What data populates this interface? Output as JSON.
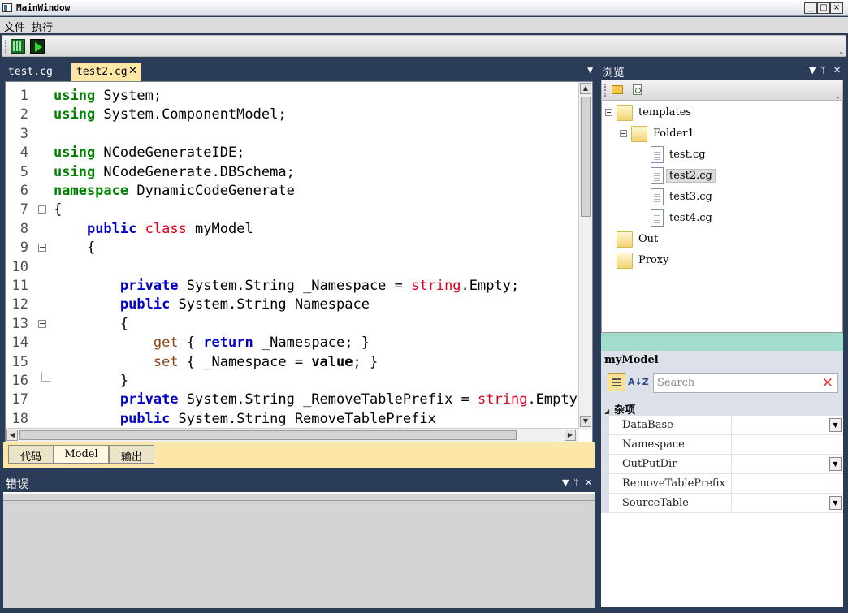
{
  "window": {
    "title": "MainWindow",
    "minimize": "_",
    "maximize": "□",
    "close": "×"
  },
  "menu": {
    "items": [
      "文件",
      "执行"
    ]
  },
  "toolbar": {
    "buttons": [
      "build-icon",
      "run-icon"
    ],
    "overflow": "⌄"
  },
  "doc_tabs": [
    {
      "label": "test.cg",
      "active": false
    },
    {
      "label": "test2.cg",
      "active": true,
      "close": "✕"
    }
  ],
  "doc_tabs_menu": "▼",
  "editor": {
    "lines": [
      {
        "n": "1",
        "fold": "",
        "segs": [
          [
            "k-green",
            "using"
          ],
          [
            "",
            " System;"
          ]
        ]
      },
      {
        "n": "2",
        "fold": "",
        "segs": [
          [
            "k-green",
            "using"
          ],
          [
            "",
            " System.ComponentModel;"
          ]
        ]
      },
      {
        "n": "3",
        "fold": "",
        "segs": []
      },
      {
        "n": "4",
        "fold": "",
        "segs": [
          [
            "k-green",
            "using"
          ],
          [
            "",
            " NCodeGenerateIDE;"
          ]
        ]
      },
      {
        "n": "5",
        "fold": "",
        "segs": [
          [
            "k-green",
            "using"
          ],
          [
            "",
            " NCodeGenerate.DBSchema;"
          ]
        ]
      },
      {
        "n": "6",
        "fold": "",
        "segs": [
          [
            "k-green",
            "namespace"
          ],
          [
            "",
            " DynamicCodeGenerate"
          ]
        ]
      },
      {
        "n": "7",
        "fold": "box",
        "segs": [
          [
            "",
            "{"
          ]
        ]
      },
      {
        "n": "8",
        "fold": "",
        "segs": [
          [
            "",
            "    "
          ],
          [
            "k-blue",
            "public"
          ],
          [
            "",
            " "
          ],
          [
            "k-red",
            "class"
          ],
          [
            "",
            " myModel"
          ]
        ]
      },
      {
        "n": "9",
        "fold": "box",
        "segs": [
          [
            "",
            "    {"
          ]
        ]
      },
      {
        "n": "10",
        "fold": "",
        "segs": []
      },
      {
        "n": "11",
        "fold": "",
        "segs": [
          [
            "",
            "        "
          ],
          [
            "k-blue",
            "private"
          ],
          [
            "",
            " System.String _Namespace = "
          ],
          [
            "k-red",
            "string"
          ],
          [
            "",
            ".Empty;"
          ]
        ]
      },
      {
        "n": "12",
        "fold": "",
        "segs": [
          [
            "",
            "        "
          ],
          [
            "k-blue",
            "public"
          ],
          [
            "",
            " System.String Namespace"
          ]
        ]
      },
      {
        "n": "13",
        "fold": "box",
        "segs": [
          [
            "",
            "        {"
          ]
        ]
      },
      {
        "n": "14",
        "fold": "",
        "segs": [
          [
            "",
            "            "
          ],
          [
            "k-brown",
            "get"
          ],
          [
            "",
            " { "
          ],
          [
            "k-blue",
            "return"
          ],
          [
            "",
            " _Namespace; }"
          ]
        ]
      },
      {
        "n": "15",
        "fold": "",
        "segs": [
          [
            "",
            "            "
          ],
          [
            "k-brown",
            "set"
          ],
          [
            "",
            " { _Namespace = "
          ],
          [
            "k-bold",
            "value"
          ],
          [
            "",
            "; }"
          ]
        ]
      },
      {
        "n": "16",
        "fold": "end",
        "segs": [
          [
            "",
            "        }"
          ]
        ]
      },
      {
        "n": "17",
        "fold": "",
        "segs": [
          [
            "",
            "        "
          ],
          [
            "k-blue",
            "private"
          ],
          [
            "",
            " System.String _RemoveTablePrefix = "
          ],
          [
            "k-red",
            "string"
          ],
          [
            "",
            ".Empty;"
          ]
        ]
      },
      {
        "n": "18",
        "fold": "",
        "segs": [
          [
            "",
            "        "
          ],
          [
            "k-blue",
            "public"
          ],
          [
            "",
            " System.String RemoveTablePrefix"
          ]
        ]
      }
    ]
  },
  "bottom_tabs": [
    {
      "label": "代码",
      "selected": false
    },
    {
      "label": "Model",
      "selected": true
    },
    {
      "label": "输出",
      "selected": false
    }
  ],
  "errors_panel": {
    "title": "错误"
  },
  "panel_controls": {
    "menu": "▼",
    "pin": "ᛘ",
    "close": "✕"
  },
  "browse_panel": {
    "title": "浏览"
  },
  "tree": [
    {
      "label": "templates",
      "kind": "folder",
      "expanded": true,
      "selected": false
    },
    {
      "label": "Folder1",
      "kind": "folder",
      "expanded": true,
      "selected": false
    },
    {
      "label": "test.cg",
      "kind": "file",
      "selected": false
    },
    {
      "label": "test2.cg",
      "kind": "file",
      "selected": true
    },
    {
      "label": "test3.cg",
      "kind": "file",
      "selected": false
    },
    {
      "label": "test4.cg",
      "kind": "file",
      "selected": false
    },
    {
      "label": "Out",
      "kind": "folder",
      "selected": false
    },
    {
      "label": "Proxy",
      "kind": "folder",
      "selected": false
    }
  ],
  "property_grid": {
    "object": "myModel",
    "search_placeholder": "Search",
    "clear": "✕",
    "sort_alpha": "A↓Z",
    "category": "杂项",
    "properties": [
      {
        "name": "DataBase",
        "value": "",
        "dropdown": true
      },
      {
        "name": "Namespace",
        "value": "",
        "dropdown": false
      },
      {
        "name": "OutPutDir",
        "value": "",
        "dropdown": true
      },
      {
        "name": "RemoveTablePrefix",
        "value": "",
        "dropdown": false
      },
      {
        "name": "SourceTable",
        "value": "",
        "dropdown": true
      }
    ]
  },
  "colors": {
    "frame": "#2b3c59",
    "active_tab": "#ffe8a6",
    "splitter": "#a2dccd"
  }
}
